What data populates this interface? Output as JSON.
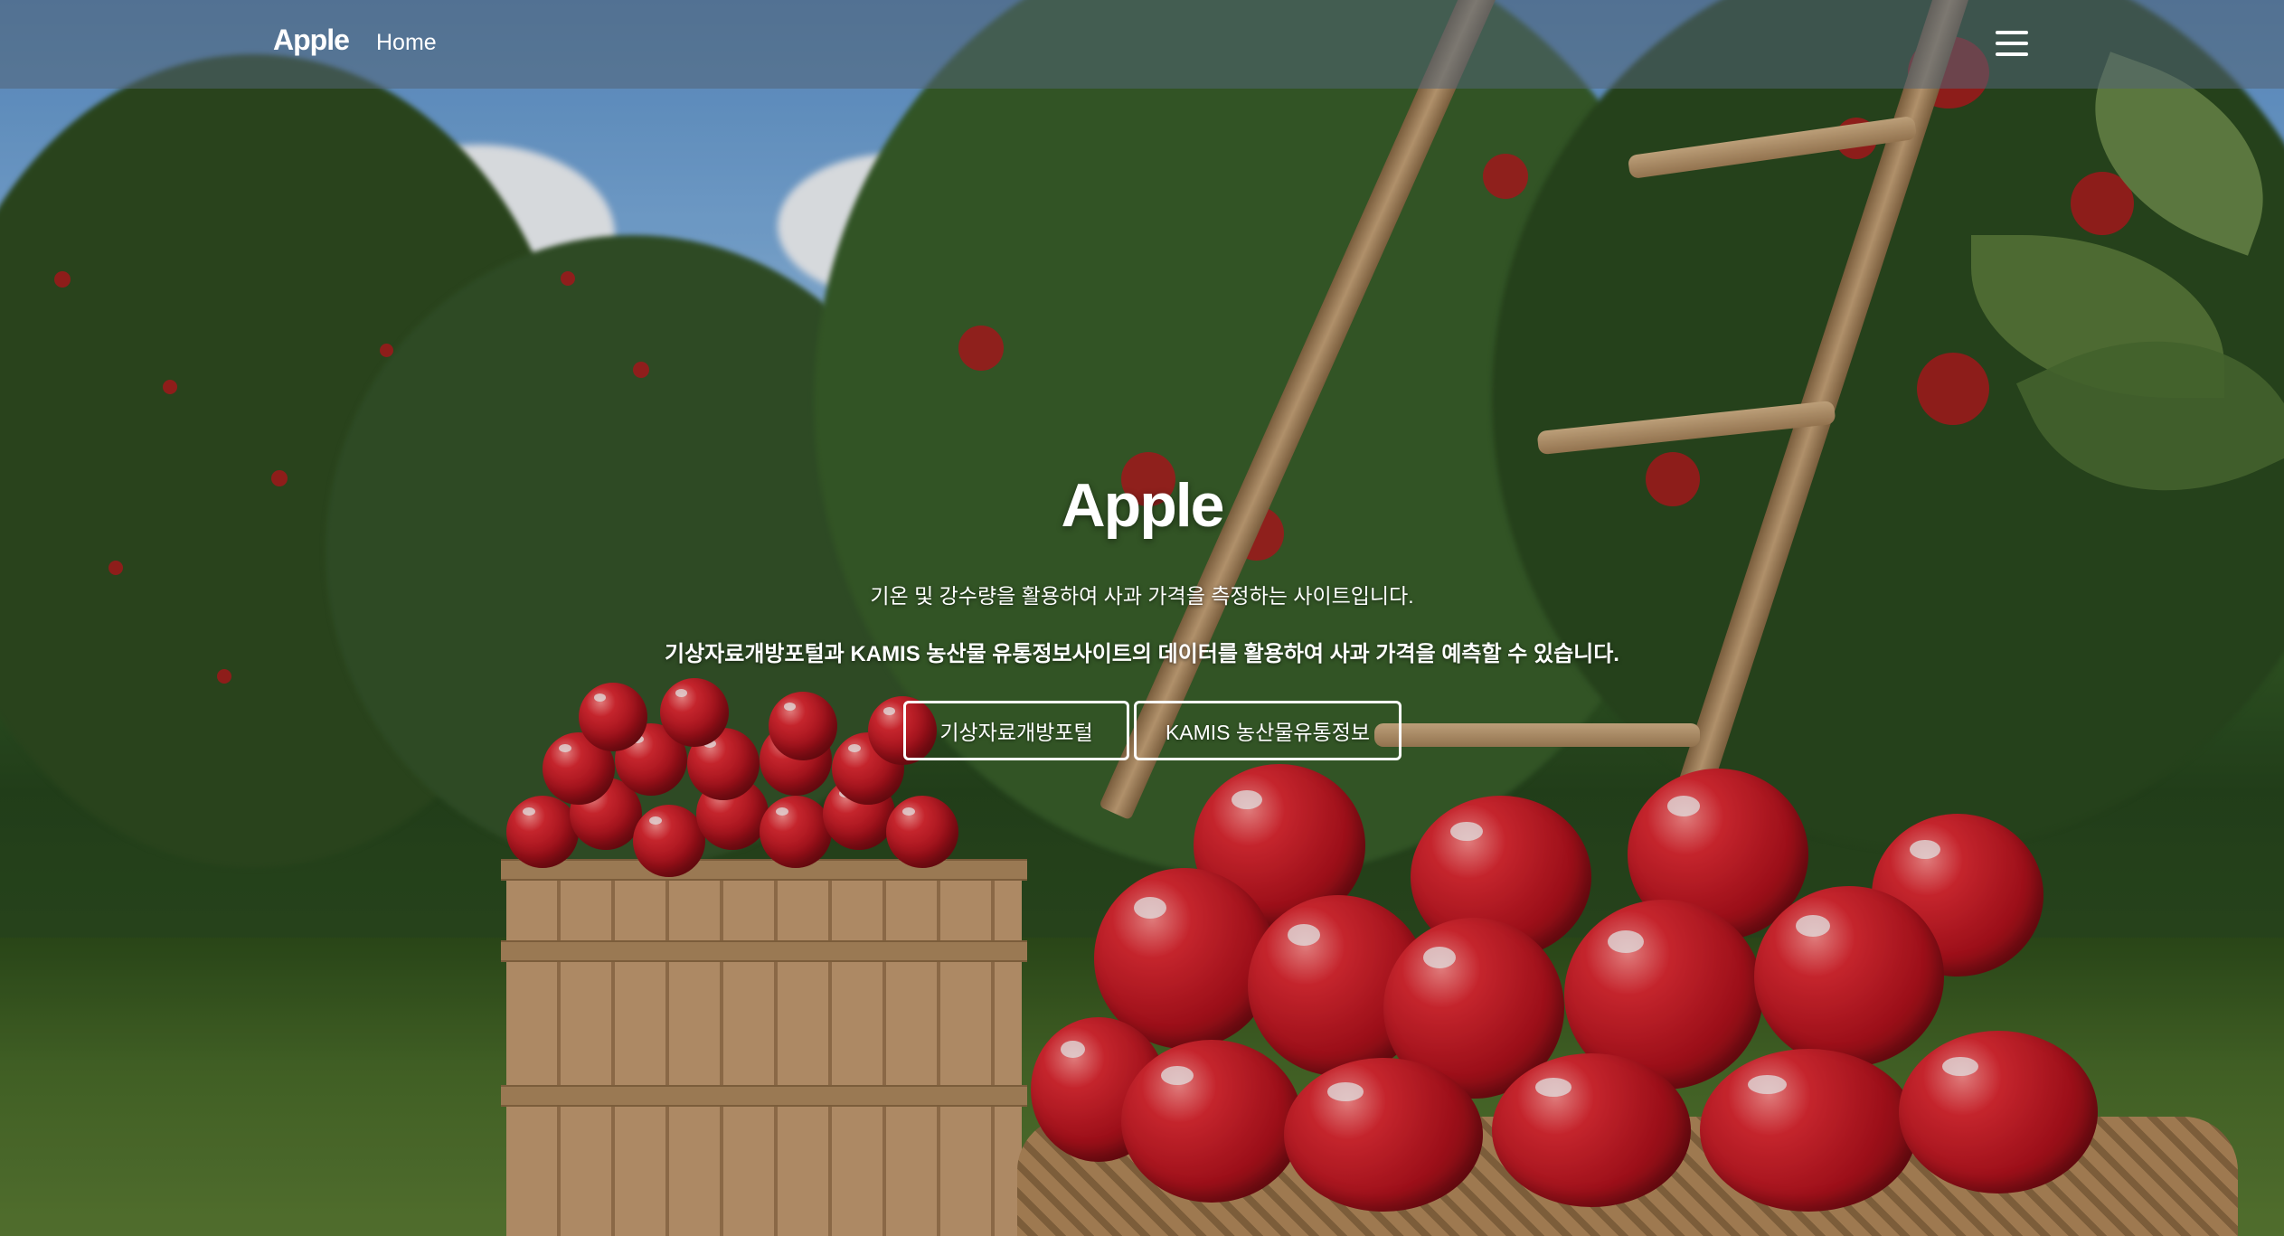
{
  "navbar": {
    "brand": "Apple",
    "links": [
      "Home"
    ],
    "menu_icon": "hamburger-menu-icon"
  },
  "hero": {
    "title": "Apple",
    "subtitle_1": "기온 및 강수량을 활용하여 사과 가격을 측정하는 사이트입니다.",
    "subtitle_2": "기상자료개방포털과 KAMIS 농산물 유통정보사이트의 데이터를 활용하여 사과 가격을 예측할 수 있습니다.",
    "buttons": [
      "기상자료개방포털",
      "KAMIS 농산물유통정보"
    ]
  },
  "colors": {
    "navbar_bg": "#526476",
    "text": "#ffffff",
    "apple_red": "#c4151f"
  }
}
